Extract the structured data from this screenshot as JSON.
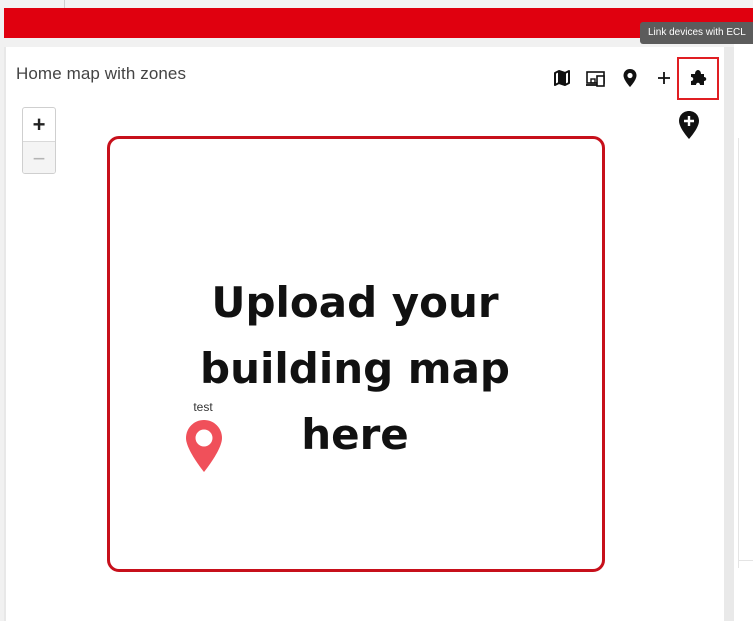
{
  "panel": {
    "title": "Home map with zones"
  },
  "toolbar": {
    "items": [
      {
        "name": "map-icon",
        "label": "Map"
      },
      {
        "name": "devices-icon",
        "label": "Devices"
      },
      {
        "name": "location-pin-icon",
        "label": "Location"
      },
      {
        "name": "plus-icon",
        "label": "Add"
      },
      {
        "name": "puzzle-icon",
        "label": "Link devices with ECL"
      }
    ],
    "tooltip": "Link devices with ECL",
    "highlight_color": "#e01e23"
  },
  "zoom": {
    "in_label": "+",
    "out_label": "−"
  },
  "map": {
    "placeholder_lines": [
      "Upload your",
      "building map",
      "here"
    ],
    "border_color": "#c7101b",
    "marker": {
      "label": "test",
      "color": "#f0505a"
    }
  },
  "colors": {
    "brand_bar": "#e0000f"
  }
}
